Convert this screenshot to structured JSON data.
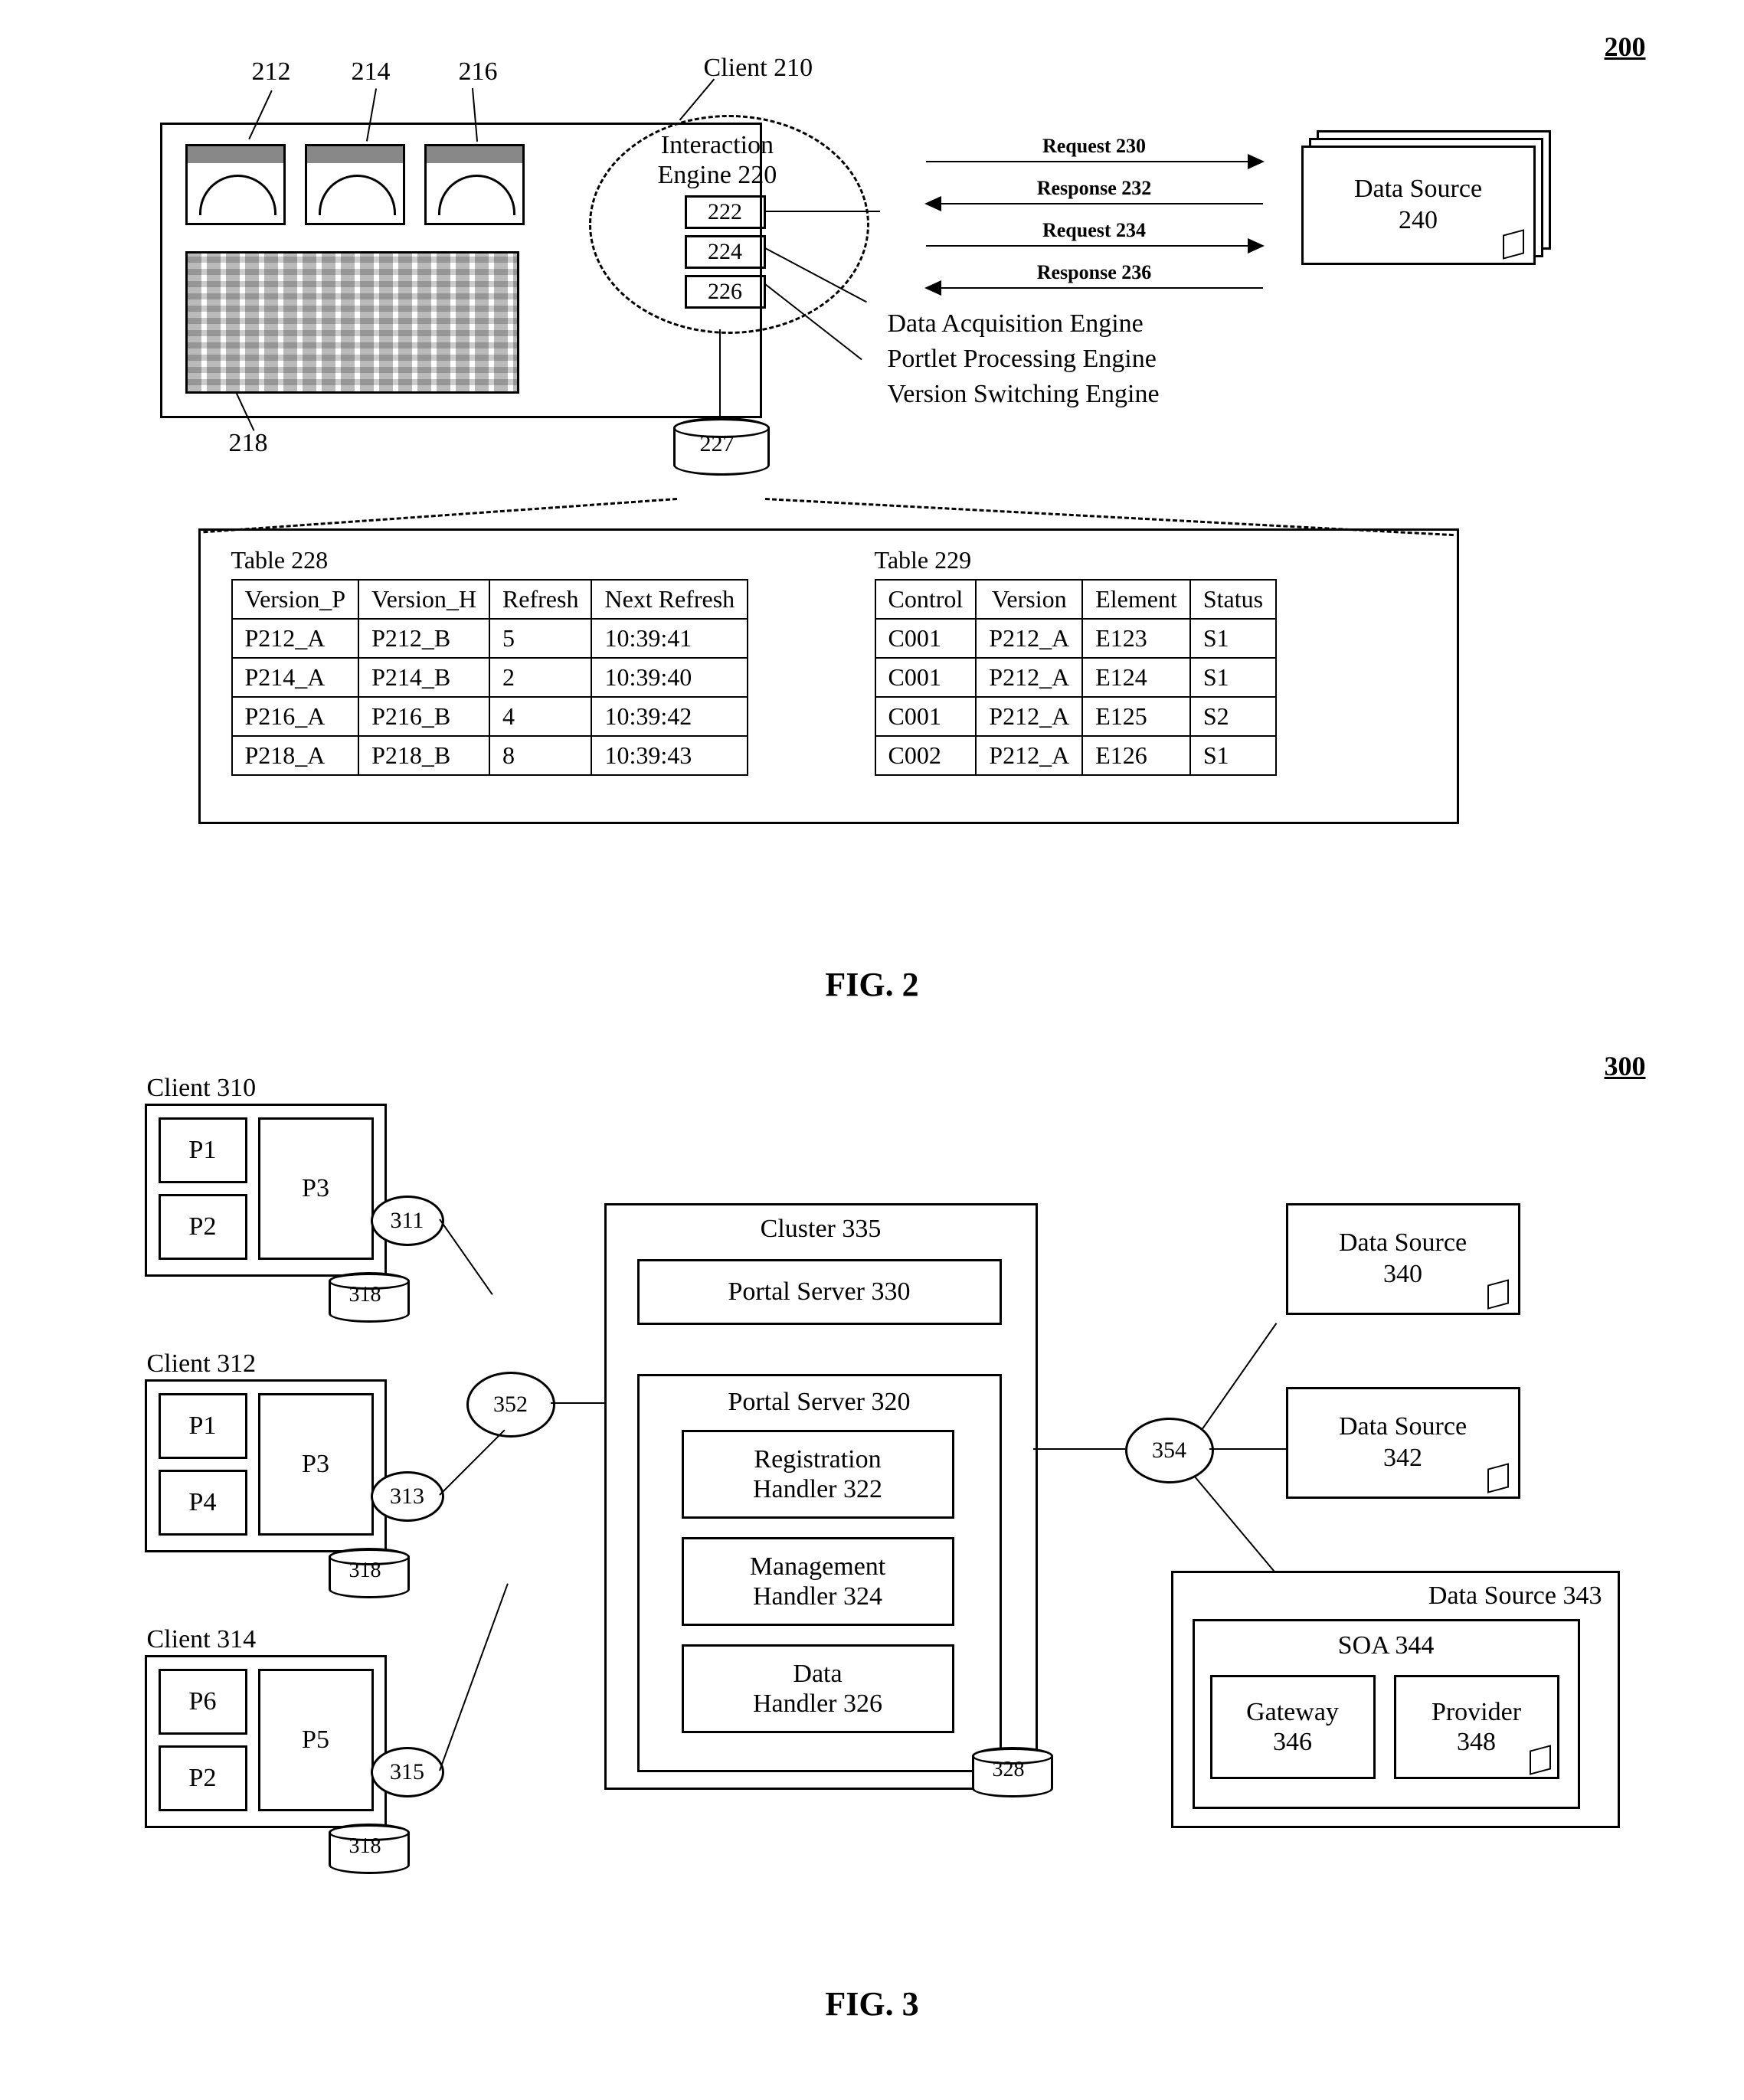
{
  "fig2": {
    "fignum": "200",
    "client_label": "Client 210",
    "gaugeRefs": {
      "g1": "212",
      "g2": "214",
      "g3": "216"
    },
    "chartRef": "218",
    "interactionEngine": {
      "line1": "Interaction",
      "line2": "Engine 220"
    },
    "ie_boxes": {
      "b1": "222",
      "b2": "224",
      "b3": "226"
    },
    "engine_lines": {
      "l1": "Data Acquisition Engine",
      "l2": "Portlet Processing Engine",
      "l3": "Version Switching Engine"
    },
    "db_label": "227",
    "arrows": {
      "a1": "Request 230",
      "a2": "Response 232",
      "a3": "Request 234",
      "a4": "Response 236"
    },
    "datasource": {
      "line1": "Data Source",
      "line2": "240"
    },
    "figcaption": "FIG. 2",
    "table228": {
      "title": "Table 228",
      "headers": [
        "Version_P",
        "Version_H",
        "Refresh",
        "Next Refresh"
      ],
      "rows": [
        [
          "P212_A",
          "P212_B",
          "5",
          "10:39:41"
        ],
        [
          "P214_A",
          "P214_B",
          "2",
          "10:39:40"
        ],
        [
          "P216_A",
          "P216_B",
          "4",
          "10:39:42"
        ],
        [
          "P218_A",
          "P218_B",
          "8",
          "10:39:43"
        ]
      ]
    },
    "table229": {
      "title": "Table 229",
      "headers": [
        "Control",
        "Version",
        "Element",
        "Status"
      ],
      "rows": [
        [
          "C001",
          "P212_A",
          "E123",
          "S1"
        ],
        [
          "C001",
          "P212_A",
          "E124",
          "S1"
        ],
        [
          "C001",
          "P212_A",
          "E125",
          "S2"
        ],
        [
          "C002",
          "P212_A",
          "E126",
          "S1"
        ]
      ]
    }
  },
  "fig3": {
    "fignum": "300",
    "figcaption": "FIG. 3",
    "clients": {
      "c310": {
        "title": "Client 310",
        "p1": "P1",
        "p2": "P2",
        "p3": "P3"
      },
      "c312": {
        "title": "Client 312",
        "p1": "P1",
        "p2": "P4",
        "p3": "P3"
      },
      "c314": {
        "title": "Client 314",
        "p1": "P6",
        "p2": "P2",
        "p3": "P5"
      }
    },
    "node311": "311",
    "node313": "313",
    "node315": "315",
    "db318": "318",
    "cloud352": "352",
    "cloud354": "354",
    "cluster_title": "Cluster 335",
    "portal330": "Portal Server 330",
    "portal320": {
      "title": "Portal Server 320",
      "reg": {
        "l1": "Registration",
        "l2": "Handler 322"
      },
      "mgmt": {
        "l1": "Management",
        "l2": "Handler 324"
      },
      "data": {
        "l1": "Data",
        "l2": "Handler 326"
      }
    },
    "db328": "328",
    "ds340": {
      "l1": "Data Source",
      "l2": "340"
    },
    "ds342": {
      "l1": "Data Source",
      "l2": "342"
    },
    "ds343": {
      "title": "Data Source 343",
      "soa": "SOA 344",
      "gateway": {
        "l1": "Gateway",
        "l2": "346"
      },
      "provider": {
        "l1": "Provider",
        "l2": "348"
      }
    }
  }
}
